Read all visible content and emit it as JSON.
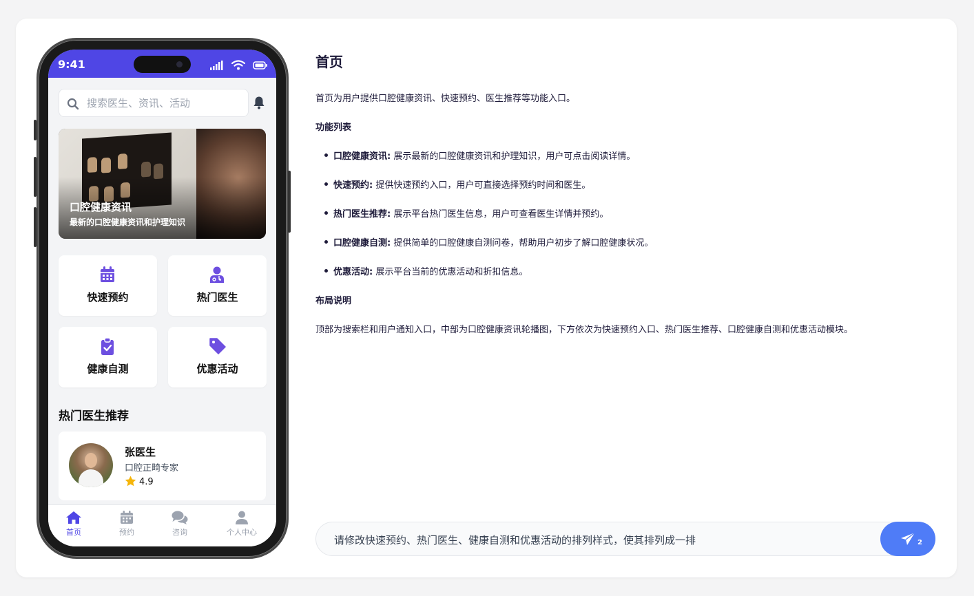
{
  "phone": {
    "status_time": "9:41",
    "search": {
      "placeholder": "搜索医生、资讯、活动"
    },
    "banner": {
      "title": "口腔健康资讯",
      "subtitle": "最新的口腔健康资讯和护理知识"
    },
    "features": [
      {
        "label": "快速预约",
        "icon": "calendar-icon"
      },
      {
        "label": "热门医生",
        "icon": "doctor-icon"
      },
      {
        "label": "健康自测",
        "icon": "clipboard-check-icon"
      },
      {
        "label": "优惠活动",
        "icon": "tag-icon"
      }
    ],
    "section_title": "热门医生推荐",
    "doctor": {
      "name": "张医生",
      "specialty": "口腔正畸专家",
      "rating": "4.9"
    },
    "tabs": [
      {
        "label": "首页",
        "icon": "home-icon",
        "active": true
      },
      {
        "label": "预约",
        "icon": "calendar-icon",
        "active": false
      },
      {
        "label": "咨询",
        "icon": "chat-icon",
        "active": false
      },
      {
        "label": "个人中心",
        "icon": "user-icon",
        "active": false
      }
    ],
    "accent_color": "#4f46e5"
  },
  "doc": {
    "title": "首页",
    "intro": "首页为用户提供口腔健康资讯、快速预约、医生推荐等功能入口。",
    "features_heading": "功能列表",
    "features": [
      {
        "name": "口腔健康资讯:",
        "desc": " 展示最新的口腔健康资讯和护理知识，用户可点击阅读详情。"
      },
      {
        "name": "快速预约:",
        "desc": " 提供快速预约入口，用户可直接选择预约时间和医生。"
      },
      {
        "name": "热门医生推荐:",
        "desc": " 展示平台热门医生信息，用户可查看医生详情并预约。"
      },
      {
        "name": "口腔健康自测:",
        "desc": " 提供简单的口腔健康自测问卷，帮助用户初步了解口腔健康状况。"
      },
      {
        "name": "优惠活动:",
        "desc": " 展示平台当前的优惠活动和折扣信息。"
      }
    ],
    "layout_heading": "布局说明",
    "layout_text": "顶部为搜索栏和用户通知入口，中部为口腔健康资讯轮播图，下方依次为快速预约入口、热门医生推荐、口腔健康自测和优惠活动模块。"
  },
  "chat": {
    "value": "请修改快速预约、热门医生、健康自测和优惠活动的排列样式，使其排列成一排",
    "send_count": "2",
    "send_color": "#4f7cf7"
  }
}
